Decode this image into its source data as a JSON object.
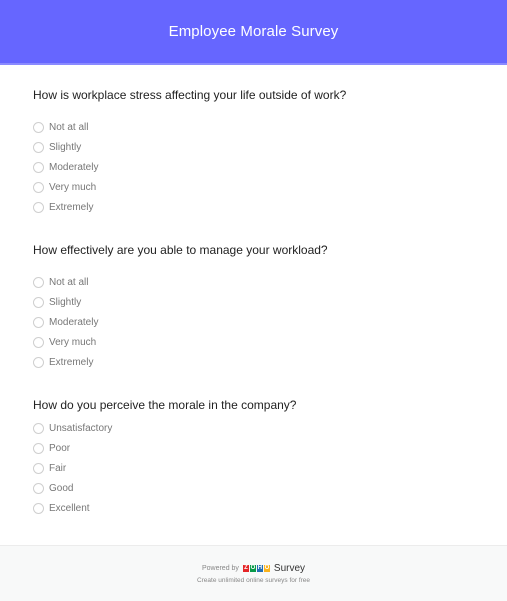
{
  "header": {
    "title": "Employee Morale Survey",
    "color": "#6666ff"
  },
  "questions": [
    {
      "title": "How is workplace stress affecting your life outside of work?",
      "options": [
        "Not at all",
        "Slightly",
        "Moderately",
        "Very much",
        "Extremely"
      ]
    },
    {
      "title": "How effectively are you able to manage your workload?",
      "options": [
        "Not at all",
        "Slightly",
        "Moderately",
        "Very much",
        "Extremely"
      ]
    },
    {
      "title": "How do you perceive the morale in the company?",
      "options": [
        "Unsatisfactory",
        "Poor",
        "Fair",
        "Good",
        "Excellent"
      ]
    }
  ],
  "footer": {
    "powered_by": "Powered by",
    "logo_letters": [
      "Z",
      "O",
      "H",
      "O"
    ],
    "logo_colors": [
      "#e42527",
      "#089949",
      "#226db4",
      "#f9b21d"
    ],
    "brand": "Survey",
    "tagline": "Create unlimited online surveys for free"
  }
}
